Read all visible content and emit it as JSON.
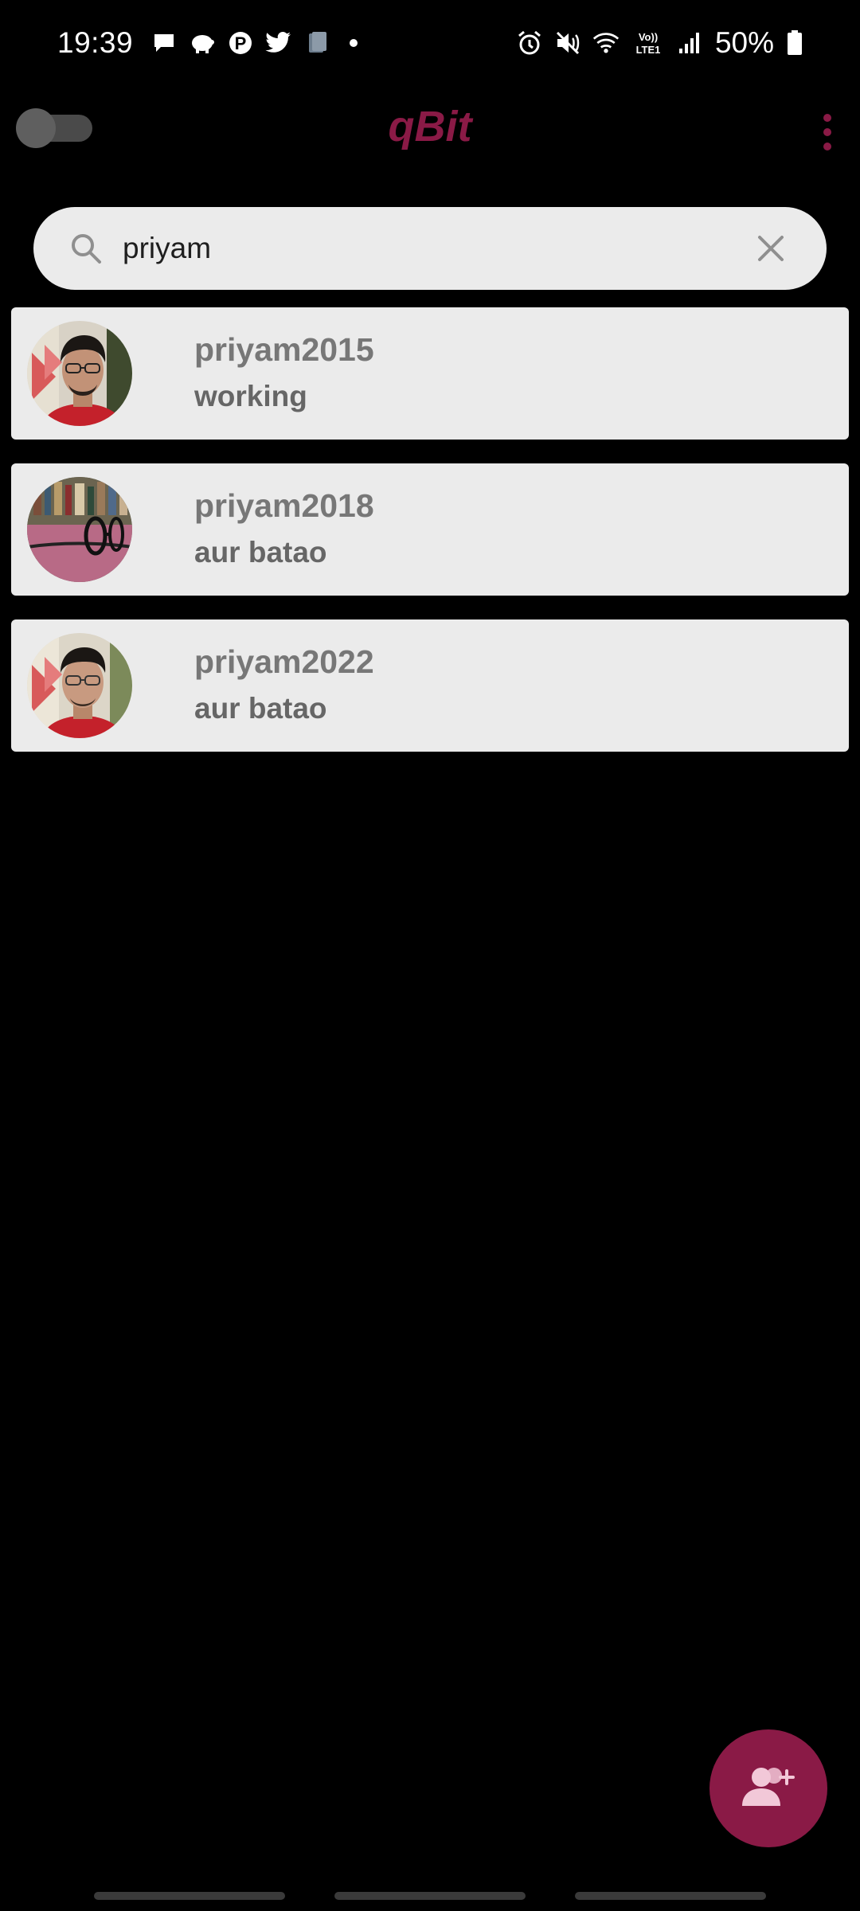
{
  "status_bar": {
    "time": "19:39",
    "battery": "50%",
    "left_icons": [
      "chat-bubble-icon",
      "piggy-bank-icon",
      "pinterest-icon",
      "twitter-icon",
      "cards-icon"
    ],
    "right_icons": [
      "alarm-icon",
      "mute-icon",
      "wifi-icon",
      "volte-icon",
      "signal-icon",
      "battery-icon"
    ],
    "volte_text": "Vo)) LTE1"
  },
  "app_bar": {
    "title": "qBit",
    "theme_toggle_on": false
  },
  "search": {
    "value": "priyam",
    "placeholder": ""
  },
  "results": [
    {
      "name": "priyam2015",
      "status": "working",
      "avatar": "person-with-glasses"
    },
    {
      "name": "priyam2018",
      "status": "aur batao",
      "avatar": "glasses-on-table"
    },
    {
      "name": "priyam2022",
      "status": "aur batao",
      "avatar": "person-with-glasses"
    }
  ],
  "fab": {
    "icon": "add-user-icon"
  },
  "colors": {
    "accent": "#8a1a46",
    "background": "#000000",
    "card": "#ebebeb"
  }
}
